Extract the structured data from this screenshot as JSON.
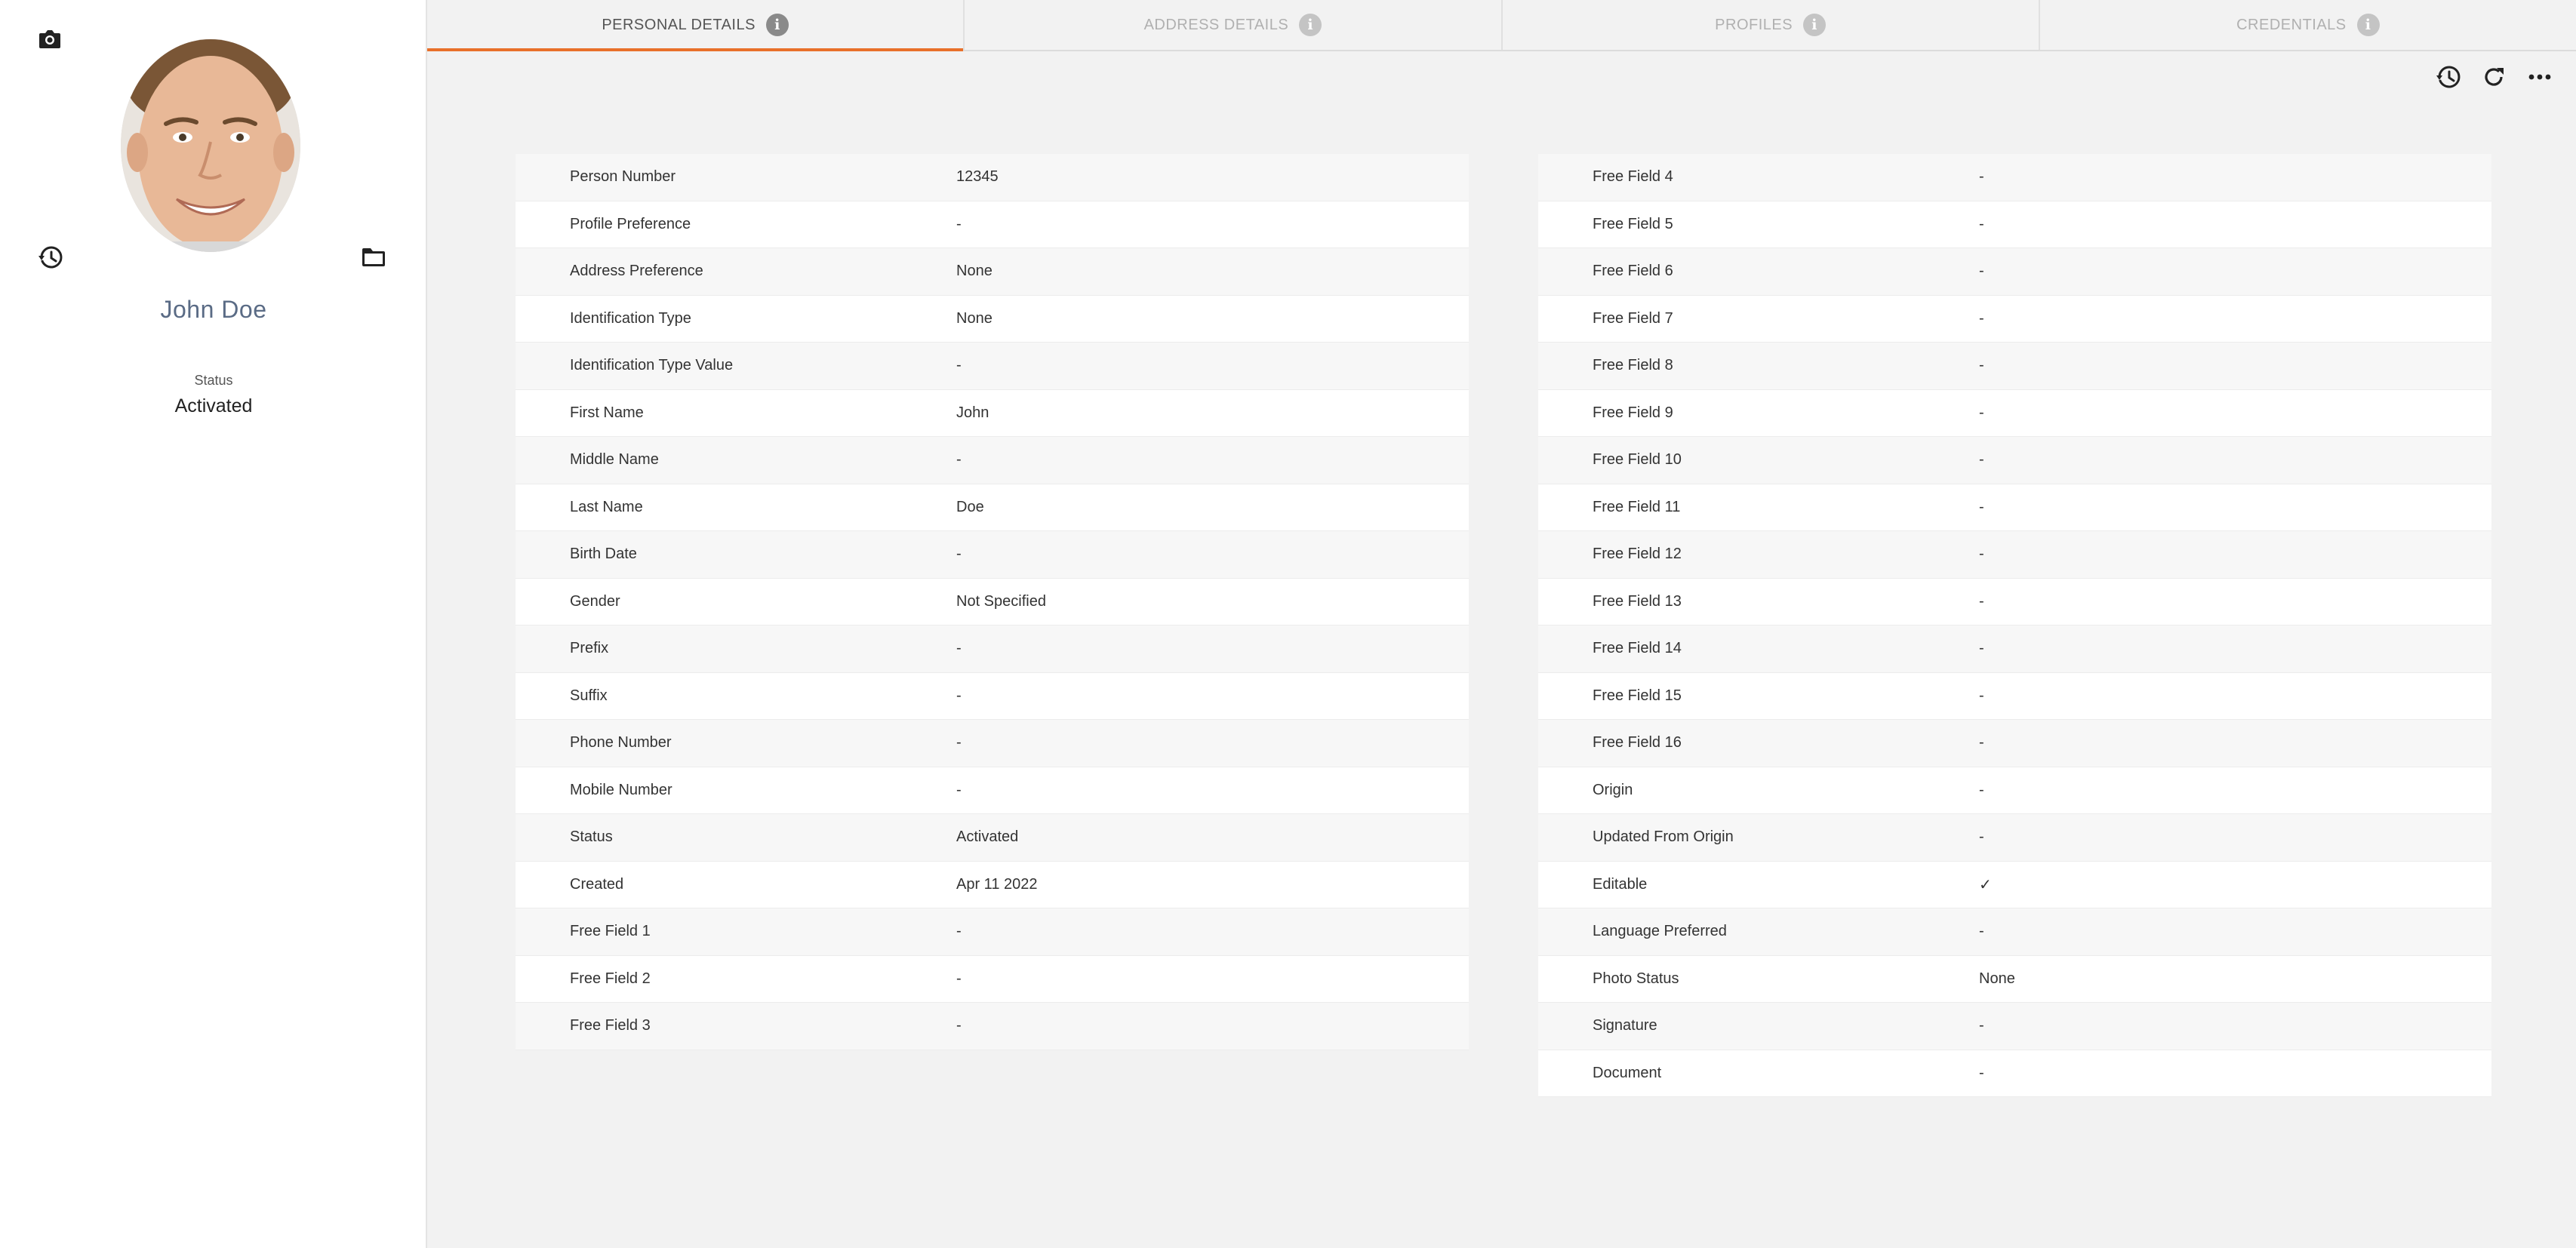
{
  "profile": {
    "name": "John Doe",
    "status_label": "Status",
    "status_value": "Activated"
  },
  "tabs": [
    {
      "label": "PERSONAL DETAILS",
      "active": true
    },
    {
      "label": "ADDRESS DETAILS",
      "active": false
    },
    {
      "label": "PROFILES",
      "active": false
    },
    {
      "label": "CREDENTIALS",
      "active": false
    }
  ],
  "icons": {
    "camera": "camera-icon",
    "history": "history-icon",
    "folder": "folder-icon",
    "refresh": "refresh-icon",
    "more": "more-horizontal-icon",
    "info": "info-icon"
  },
  "colors": {
    "accent": "#e8702a",
    "name_text": "#5a6b85"
  },
  "left_table": [
    {
      "label": "Person Number",
      "value": "12345"
    },
    {
      "label": "Profile Preference",
      "value": "-"
    },
    {
      "label": "Address Preference",
      "value": "None"
    },
    {
      "label": "Identification Type",
      "value": "None"
    },
    {
      "label": "Identification Type Value",
      "value": "-"
    },
    {
      "label": "First Name",
      "value": "John"
    },
    {
      "label": "Middle Name",
      "value": "-"
    },
    {
      "label": "Last Name",
      "value": "Doe"
    },
    {
      "label": "Birth Date",
      "value": "-"
    },
    {
      "label": "Gender",
      "value": "Not Specified"
    },
    {
      "label": "Prefix",
      "value": "-"
    },
    {
      "label": "Suffix",
      "value": "-"
    },
    {
      "label": "Phone Number",
      "value": "-"
    },
    {
      "label": "Mobile Number",
      "value": "-"
    },
    {
      "label": "Status",
      "value": "Activated"
    },
    {
      "label": "Created",
      "value": "Apr 11 2022"
    },
    {
      "label": "Free Field 1",
      "value": "-"
    },
    {
      "label": "Free Field 2",
      "value": "-"
    },
    {
      "label": "Free Field 3",
      "value": "-"
    }
  ],
  "right_table": [
    {
      "label": "Free Field 4",
      "value": "-"
    },
    {
      "label": "Free Field 5",
      "value": "-"
    },
    {
      "label": "Free Field 6",
      "value": "-"
    },
    {
      "label": "Free Field 7",
      "value": "-"
    },
    {
      "label": "Free Field 8",
      "value": "-"
    },
    {
      "label": "Free Field 9",
      "value": "-"
    },
    {
      "label": "Free Field 10",
      "value": "-"
    },
    {
      "label": "Free Field 11",
      "value": "-"
    },
    {
      "label": "Free Field 12",
      "value": "-"
    },
    {
      "label": "Free Field 13",
      "value": "-"
    },
    {
      "label": "Free Field 14",
      "value": "-"
    },
    {
      "label": "Free Field 15",
      "value": "-"
    },
    {
      "label": "Free Field 16",
      "value": "-"
    },
    {
      "label": "Origin",
      "value": "-"
    },
    {
      "label": "Updated From Origin",
      "value": "-"
    },
    {
      "label": "Editable",
      "value": "✓"
    },
    {
      "label": "Language Preferred",
      "value": "-"
    },
    {
      "label": "Photo Status",
      "value": "None"
    },
    {
      "label": "Signature",
      "value": "-"
    },
    {
      "label": "Document",
      "value": "-"
    }
  ]
}
